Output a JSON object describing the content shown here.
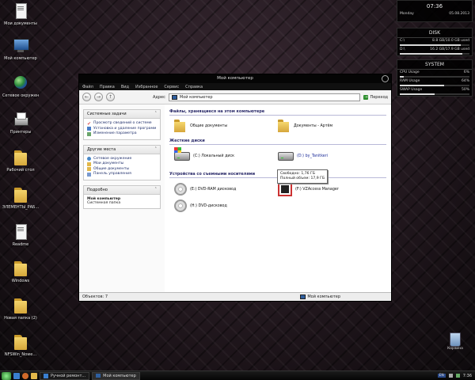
{
  "desktop": {
    "icons": [
      {
        "label": "Мои документы",
        "icon": "documents-icon"
      },
      {
        "label": "Мой компьютер",
        "icon": "computer-icon"
      },
      {
        "label": "Сетевое окружение",
        "icon": "network-icon"
      },
      {
        "label": "Принтеры",
        "icon": "printer-icon"
      },
      {
        "label": "Рабочий стол",
        "icon": "folder-icon"
      },
      {
        "label": "ЭЛЕМЕНТЫ_РАБ...",
        "icon": "folder-icon"
      },
      {
        "label": "Readme",
        "icon": "document-icon"
      },
      {
        "label": "Windows",
        "icon": "folder-icon"
      },
      {
        "label": "Новая папка (2)",
        "icon": "folder-icon"
      },
      {
        "label": "NFSWin_Nowe...",
        "icon": "folder-icon"
      }
    ],
    "recycle_label": "Корзина"
  },
  "sidebar": {
    "clock": {
      "time": "07:36",
      "day": "Monday",
      "date": "05.08.2013"
    },
    "disk": {
      "title": "DISK",
      "rows": [
        {
          "label": "C:\\",
          "value": "8.8 GB/10.0 GB used",
          "fill": 0.88
        },
        {
          "label": "D:\\",
          "value": "16.2 GB/17.9 GB used",
          "fill": 0.9
        }
      ]
    },
    "system": {
      "title": "SYSTEM",
      "rows": [
        {
          "label": "CPU Usage",
          "value": "6%",
          "fill": 0.06
        },
        {
          "label": "RAM Usage",
          "value": "64%",
          "fill": 0.64
        },
        {
          "label": "SWAP Usage",
          "value": "50%",
          "fill": 0.5
        }
      ]
    }
  },
  "window": {
    "title": "Мой компьютер",
    "menu": [
      "Файл",
      "Правка",
      "Вид",
      "Избранное",
      "Сервис",
      "Справка"
    ],
    "toolbar": {
      "address_label": "Адрес",
      "address_value": "Мой компьютер",
      "go_label": "Переход"
    },
    "tasks_panel": {
      "title": "Системные задачи",
      "items": [
        "Просмотр сведений о системе",
        "Установка и удаление программ",
        "Изменение параметра"
      ]
    },
    "places_panel": {
      "title": "Другие места",
      "items": [
        "Сетевое окружение",
        "Мои документы",
        "Общие документы",
        "Панель управления"
      ]
    },
    "details_panel": {
      "title": "Подробно",
      "name": "Мой компьютер",
      "type": "Системная папка"
    },
    "sections": {
      "files_title": "Файлы, хранящиеся на этом компьютере",
      "drives_title": "Жесткие диски",
      "removable_title": "Устройства со съемными носителями"
    },
    "files": [
      "Общие документы",
      "Документы - Артём"
    ],
    "drives": [
      "(C:) Локальный диск",
      "(D:) by_Tanitkeri"
    ],
    "removable": [
      "(E:) DVD-RAM дисковод",
      "(F:) VZAccess Manager",
      "(H:) DVD-дисковод"
    ],
    "tooltip": {
      "free": "Свободно: 1,76 ГБ",
      "total": "Полный объем: 17,9 ГБ"
    },
    "status": {
      "left": "Объектов: 7",
      "right": "Мой компьютер"
    }
  },
  "taskbar": {
    "tasks": [
      "Ручной ремонт...",
      "Мой компьютер"
    ],
    "lang": "EN",
    "time": "7:36"
  }
}
